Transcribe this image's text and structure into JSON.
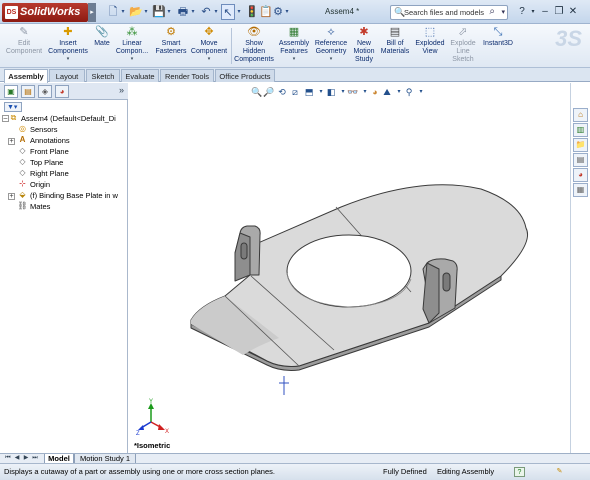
{
  "app": {
    "logo": "SolidWorks",
    "logo_badge": "DS",
    "doc_title": "Assem4 *"
  },
  "quick_access": [
    "new-icon",
    "open-icon",
    "save-icon",
    "print-icon",
    "undo-icon",
    "select-icon",
    "rebuild-icon",
    "options-icon"
  ],
  "search": {
    "placeholder": "Search files and models"
  },
  "commands": [
    {
      "label": "Edit\nComponent",
      "icon": "edit-component-icon",
      "disabled": true
    },
    {
      "label": "Insert\nComponents",
      "icon": "insert-components-icon",
      "dropdown": true
    },
    {
      "label": "Mate",
      "icon": "mate-icon"
    },
    {
      "label": "Linear\nCompon...",
      "icon": "linear-pattern-icon",
      "dropdown": true
    },
    {
      "label": "Smart\nFasteners",
      "icon": "smart-fasteners-icon"
    },
    {
      "label": "Move\nComponent",
      "icon": "move-component-icon",
      "dropdown": true
    },
    {
      "label": "Show\nHidden\nComponents",
      "icon": "show-hidden-icon"
    },
    {
      "label": "Assembly\nFeatures",
      "icon": "assembly-features-icon",
      "dropdown": true
    },
    {
      "label": "Reference\nGeometry",
      "icon": "reference-geometry-icon",
      "dropdown": true
    },
    {
      "label": "New\nMotion\nStudy",
      "icon": "motion-study-icon"
    },
    {
      "label": "Bill of\nMaterials",
      "icon": "bom-icon"
    },
    {
      "label": "Exploded\nView",
      "icon": "exploded-view-icon"
    },
    {
      "label": "Explode\nLine\nSketch",
      "icon": "explode-line-icon",
      "disabled": true
    },
    {
      "label": "Instant3D",
      "icon": "instant3d-icon"
    }
  ],
  "tabs": [
    "Assembly",
    "Layout",
    "Sketch",
    "Evaluate",
    "Render Tools",
    "Office Products"
  ],
  "tree": [
    {
      "label": "Assem4  (Default<Default_Di",
      "icon": "assembly-icon",
      "expander": "-"
    },
    {
      "label": "Sensors",
      "icon": "sensors-icon"
    },
    {
      "label": "Annotations",
      "icon": "annotations-icon",
      "expander": "+"
    },
    {
      "label": "Front Plane",
      "icon": "plane-icon"
    },
    {
      "label": "Top Plane",
      "icon": "plane-icon"
    },
    {
      "label": "Right Plane",
      "icon": "plane-icon"
    },
    {
      "label": "Origin",
      "icon": "origin-icon"
    },
    {
      "label": "(f) Binding Base Plate in w",
      "icon": "part-icon",
      "expander": "+"
    },
    {
      "label": "Mates",
      "icon": "mates-icon"
    }
  ],
  "view": {
    "orientation": "*Isometric"
  },
  "bottom_tabs": [
    "Model",
    "Motion Study 1"
  ],
  "status": {
    "message": "Displays a cutaway of a part or assembly using one or more cross section planes.",
    "state": "Fully Defined",
    "mode": "Editing Assembly"
  },
  "colors": {
    "accent": "#0c2c6e",
    "part_fill": "#dcdcdc",
    "part_edge": "#3a3a3a"
  }
}
